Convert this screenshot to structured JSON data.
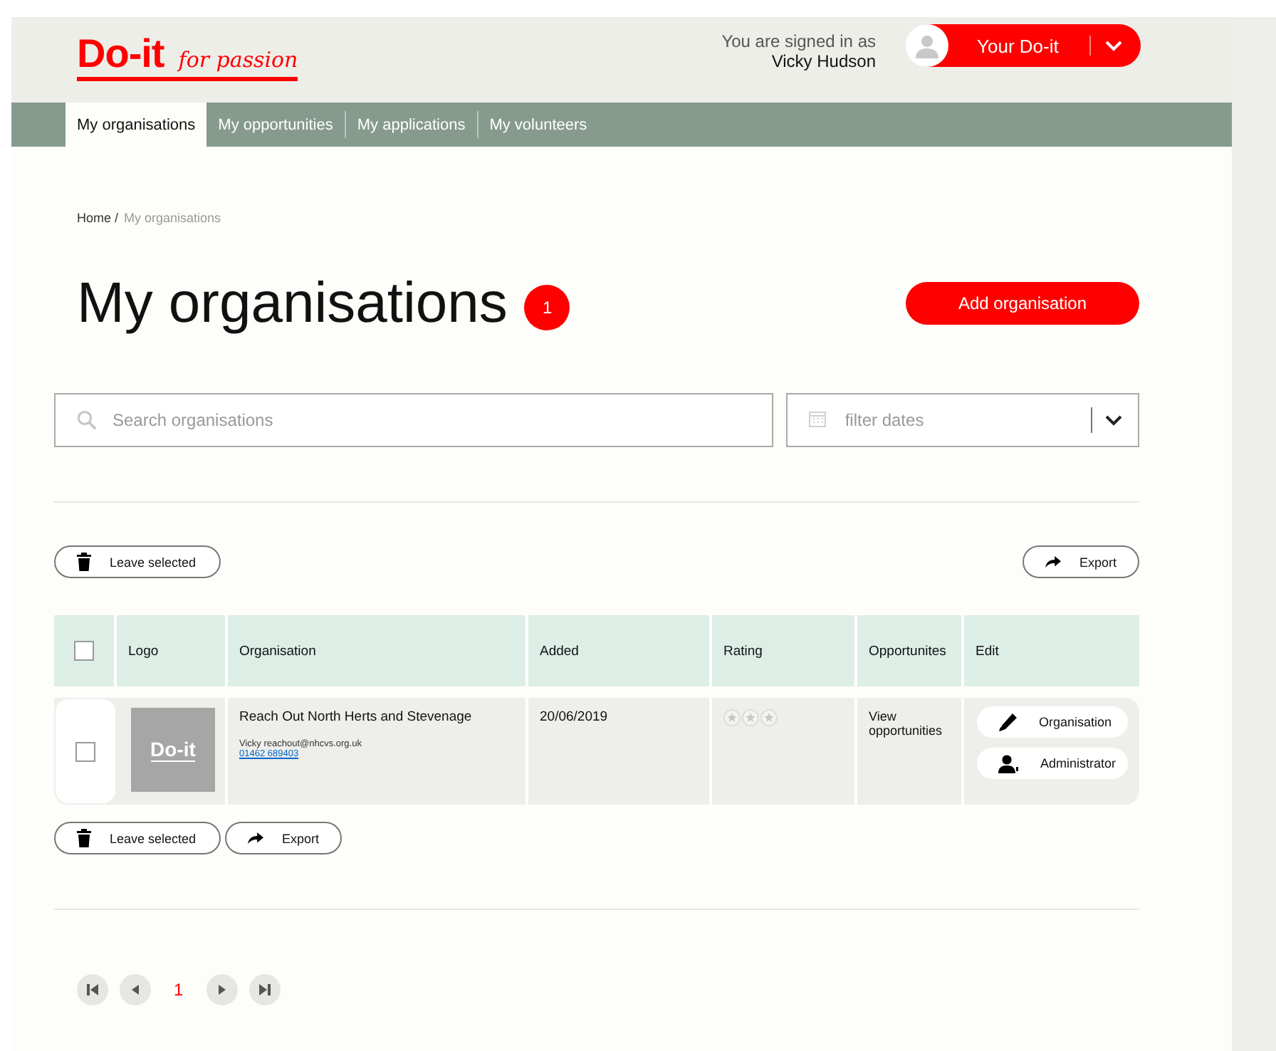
{
  "header": {
    "logo": "Do-it",
    "tagline": "for passion",
    "signed_in_label": "You are signed in as",
    "user_name": "Vicky Hudson",
    "account_button": "Your Do-it"
  },
  "tabs": [
    {
      "label": "My organisations",
      "selected": true
    },
    {
      "label": "My opportunities",
      "selected": false
    },
    {
      "label": "My applications",
      "selected": false
    },
    {
      "label": "My volunteers",
      "selected": false
    }
  ],
  "breadcrumb": [
    {
      "label": "Home /",
      "current": false
    },
    {
      "label": "My organisations",
      "current": true
    }
  ],
  "page_title": "My organisations",
  "count_badge": "1",
  "add_button": "Add organisation",
  "search": {
    "placeholder": "Search organisations"
  },
  "date_filter": {
    "placeholder": "filter dates"
  },
  "top_actions": [
    {
      "kind": "leave",
      "label": "Leave selected"
    },
    {
      "kind": "export",
      "label": "Export"
    }
  ],
  "table": {
    "select_all": {
      "checked": false
    },
    "columns": [
      "Logo",
      "Organisation",
      "Added",
      "Rating",
      "Opportunites",
      "Edit"
    ],
    "rows": [
      {
        "checked": false,
        "logo": "Do-it",
        "name": "Reach Out North Herts and Stevenage",
        "contact": "Vicky reachout@nhcvs.org.uk",
        "phone": "01462 689403",
        "added": "20/06/2019",
        "stars": 0,
        "opportunities_link": "View opportunities",
        "edit_buttons": [
          {
            "kind": "organisation",
            "label": "Organisation"
          },
          {
            "kind": "administrator",
            "label": "Administrator"
          }
        ]
      }
    ]
  },
  "bottom_actions": [
    {
      "kind": "leave",
      "label": "Leave selected"
    },
    {
      "kind": "export",
      "label": "Export"
    }
  ],
  "pagination": {
    "pages": [
      {
        "label": "1",
        "selected": true
      }
    ]
  }
}
